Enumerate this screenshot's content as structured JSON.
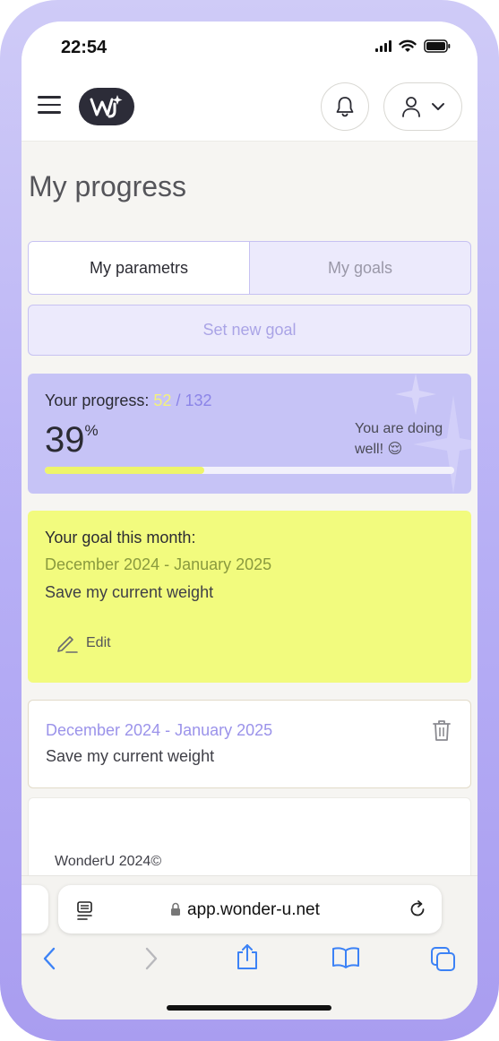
{
  "status_bar": {
    "time": "22:54"
  },
  "header": {
    "logo_text": "WU"
  },
  "page": {
    "title": "My progress"
  },
  "tabs": [
    {
      "label": "My parametrs",
      "active": true
    },
    {
      "label": "My goals",
      "active": false
    }
  ],
  "set_goal_label": "Set new goal",
  "progress": {
    "label": "Your progress:",
    "current": "52",
    "separator": "/",
    "total": "132",
    "percent": "39",
    "percent_sign": "%",
    "message": "You are doing well! 😌",
    "fill_fraction": 0.39
  },
  "goal_card": {
    "heading": "Your goal this month:",
    "dates": "December 2024 - January 2025",
    "goal": "Save my current weight",
    "edit_label": "Edit"
  },
  "history_card": {
    "dates": "December 2024 - January 2025",
    "goal": "Save my current weight"
  },
  "footer": {
    "copyright": "WonderU 2024©"
  },
  "browser": {
    "url": "app.wonder-u.net"
  },
  "colors": {
    "accent_purple": "#c6c3f6",
    "goal_yellow": "#f2fb7e",
    "progress_fill": "#eef56a",
    "frame": "#b6aef5"
  }
}
